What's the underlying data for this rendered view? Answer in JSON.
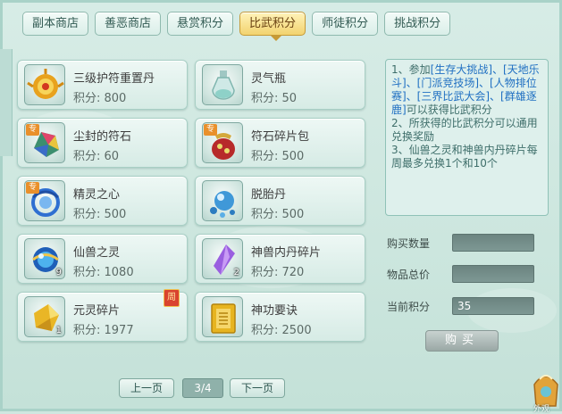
{
  "tabs": [
    {
      "label": "副本商店",
      "active": false
    },
    {
      "label": "善恶商店",
      "active": false
    },
    {
      "label": "悬赏积分",
      "active": false
    },
    {
      "label": "比武积分",
      "active": true
    },
    {
      "label": "师徒积分",
      "active": false
    },
    {
      "label": "挑战积分",
      "active": false
    }
  ],
  "items": [
    {
      "name": "三级护符重置丹",
      "price": "积分: 800",
      "icon": "golden-flower-pill-icon",
      "badge": "",
      "count": "",
      "week": ""
    },
    {
      "name": "灵气瓶",
      "price": "积分: 50",
      "icon": "spirit-bottle-icon",
      "badge": "",
      "count": "",
      "week": ""
    },
    {
      "name": "尘封的符石",
      "price": "积分: 60",
      "icon": "sealed-rune-stone-icon",
      "badge": "专",
      "count": "",
      "week": ""
    },
    {
      "name": "符石碎片包",
      "price": "积分: 500",
      "icon": "rune-fragment-bag-icon",
      "badge": "专",
      "count": "",
      "week": ""
    },
    {
      "name": "精灵之心",
      "price": "积分: 500",
      "icon": "spirit-heart-icon",
      "badge": "专",
      "count": "",
      "week": ""
    },
    {
      "name": "脱胎丹",
      "price": "积分: 500",
      "icon": "rebirth-pill-icon",
      "badge": "",
      "count": "",
      "week": ""
    },
    {
      "name": "仙兽之灵",
      "price": "积分: 1080",
      "icon": "immortal-beast-orb-icon",
      "badge": "",
      "count": "9",
      "week": ""
    },
    {
      "name": "神兽内丹碎片",
      "price": "积分: 720",
      "icon": "beast-core-fragment-icon",
      "badge": "",
      "count": "2",
      "week": ""
    },
    {
      "name": "元灵碎片",
      "price": "积分: 1977",
      "icon": "yuanling-fragment-icon",
      "badge": "",
      "count": "1",
      "week": "周"
    },
    {
      "name": "神功要诀",
      "price": "积分: 2500",
      "icon": "martial-manual-icon",
      "badge": "",
      "count": "",
      "week": ""
    }
  ],
  "info": {
    "p1_a": "1、参加",
    "p1_b": "[生存大挑战]、[天地乐斗]、[门派竞技场]、[人物排位赛]、[三界比武大会]、[群雄逐鹿]",
    "p1_c": "可以获得比武积分",
    "p2": "2、所获得的比武积分可以通用兑换奖励",
    "p3": "3、仙兽之灵和神兽内丹碎片每周最多兑换1个和10个"
  },
  "form": {
    "qty_label": "购买数量",
    "qty_value": "",
    "total_label": "物品总价",
    "total_value": "",
    "points_label": "当前积分",
    "points_value": "35",
    "buy_label": "购买"
  },
  "pager": {
    "prev_label": "上一页",
    "page": "3/4",
    "next_label": "下一页"
  },
  "corner": {
    "label": "外观"
  }
}
